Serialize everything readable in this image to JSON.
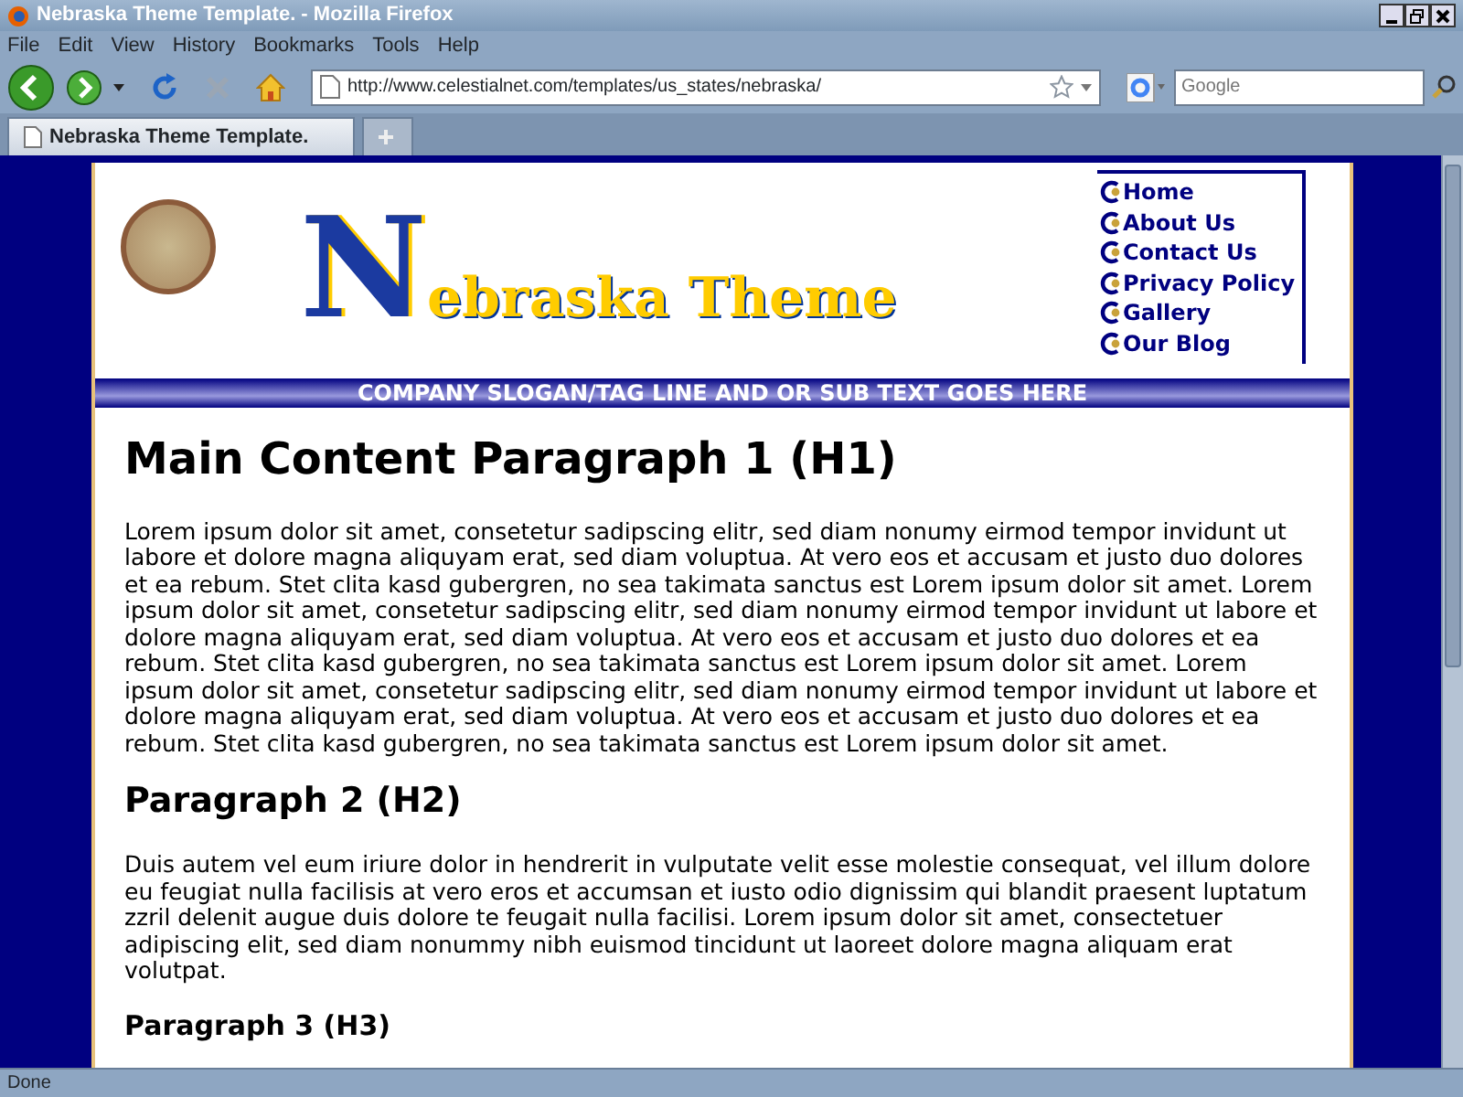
{
  "window": {
    "title": "Nebraska Theme Template. - Mozilla Firefox"
  },
  "menu": [
    "File",
    "Edit",
    "View",
    "History",
    "Bookmarks",
    "Tools",
    "Help"
  ],
  "address_bar": {
    "url": "http://www.celestialnet.com/templates/us_states/nebraska/"
  },
  "search": {
    "placeholder": "Google"
  },
  "tabs": [
    {
      "label": "Nebraska Theme Template.",
      "selected": true
    }
  ],
  "header": {
    "logo": "Nebraska Theme",
    "nav": [
      "Home",
      "About Us",
      "Contact Us",
      "Privacy Policy",
      "Gallery",
      "Our Blog"
    ],
    "slogan": "COMPANY SLOGAN/TAG LINE AND OR SUB TEXT GOES HERE"
  },
  "content": [
    {
      "kind": "h1",
      "text": "Main Content Paragraph 1 (H1)"
    },
    {
      "kind": "p",
      "text": "Lorem ipsum dolor sit amet, consetetur sadipscing elitr, sed diam nonumy eirmod tempor invidunt ut labore et dolore magna aliquyam erat, sed diam voluptua. At vero eos et accusam et justo duo dolores et ea rebum. Stet clita kasd gubergren, no sea takimata sanctus est Lorem ipsum dolor sit amet. Lorem ipsum dolor sit amet, consetetur sadipscing elitr, sed diam nonumy eirmod tempor invidunt ut labore et dolore magna aliquyam erat, sed diam voluptua. At vero eos et accusam et justo duo dolores et ea rebum. Stet clita kasd gubergren, no sea takimata sanctus est Lorem ipsum dolor sit amet. Lorem ipsum dolor sit amet, consetetur sadipscing elitr, sed diam nonumy eirmod tempor invidunt ut labore et dolore magna aliquyam erat, sed diam voluptua. At vero eos et accusam et justo duo dolores et ea rebum. Stet clita kasd gubergren, no sea takimata sanctus est Lorem ipsum dolor sit amet."
    },
    {
      "kind": "h2",
      "text": "Paragraph 2 (H2)"
    },
    {
      "kind": "p",
      "text": "Duis autem vel eum iriure dolor in hendrerit in vulputate velit esse molestie consequat, vel illum dolore eu feugiat nulla facilisis at vero eros et accumsan et iusto odio dignissim qui blandit praesent luptatum zzril delenit augue duis dolore te feugait nulla facilisi. Lorem ipsum dolor sit amet, consectetuer adipiscing elit, sed diam nonummy nibh euismod tincidunt ut laoreet dolore magna aliquam erat volutpat."
    },
    {
      "kind": "h3",
      "text": "Paragraph 3 (H3)"
    }
  ],
  "status_bar": "Done"
}
